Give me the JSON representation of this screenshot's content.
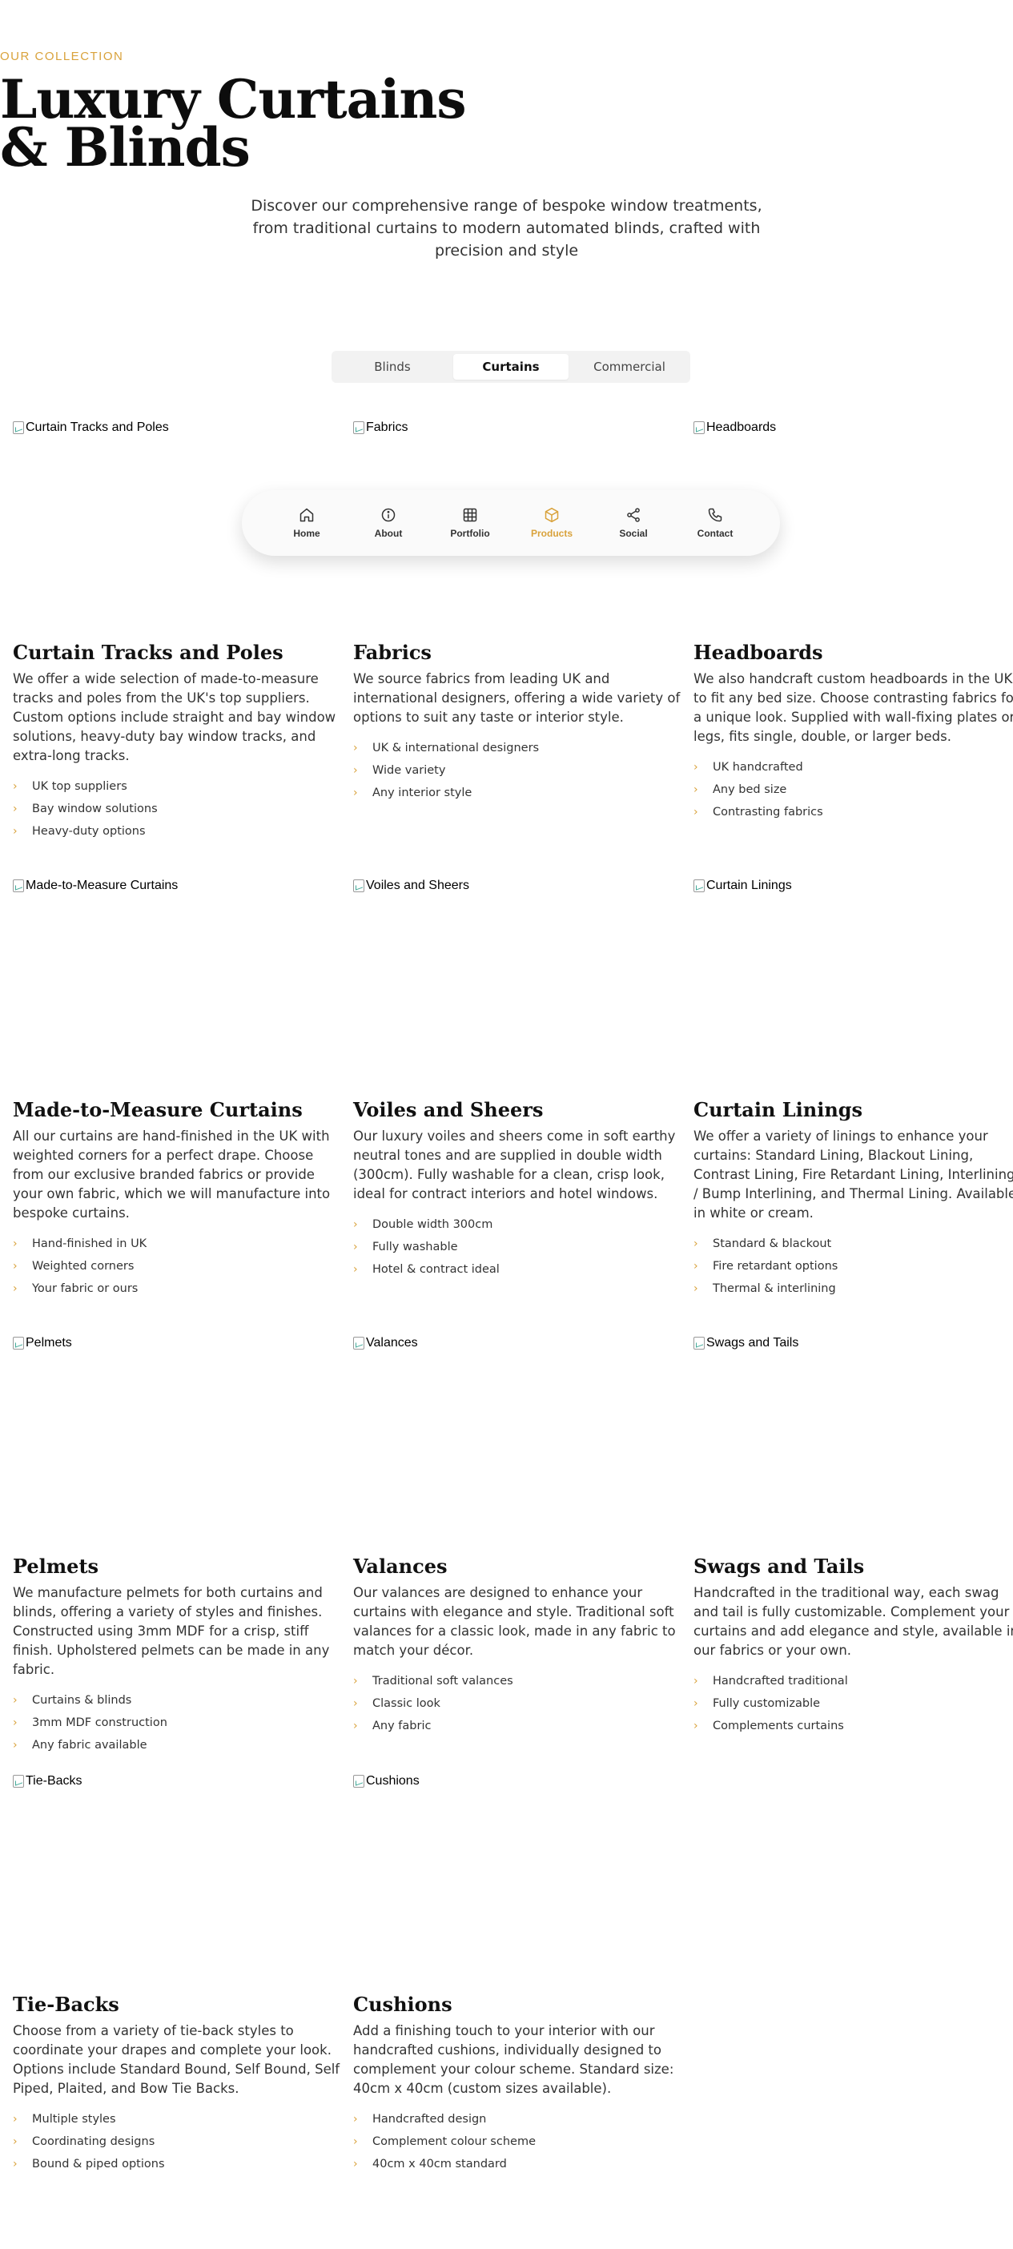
{
  "hero": {
    "eyebrow": "OUR COLLECTION",
    "title_line1": "Luxury Curtains",
    "title_line2": "& Blinds",
    "subtitle": "Discover our comprehensive range of bespoke window treatments, from traditional curtains to modern automated blinds, crafted with precision and style"
  },
  "tabs": [
    {
      "label": "Blinds",
      "active": false
    },
    {
      "label": "Curtains",
      "active": true
    },
    {
      "label": "Commercial",
      "active": false
    }
  ],
  "nav": [
    {
      "label": "Home",
      "icon": "home-icon"
    },
    {
      "label": "About",
      "icon": "info-icon"
    },
    {
      "label": "Portfolio",
      "icon": "grid-icon"
    },
    {
      "label": "Products",
      "icon": "box-icon",
      "active": true
    },
    {
      "label": "Social",
      "icon": "share-icon"
    },
    {
      "label": "Contact",
      "icon": "phone-icon"
    }
  ],
  "accent_color": "#d9a23b",
  "products": [
    {
      "alt": "Curtain Tracks and Poles",
      "title": "Curtain Tracks and Poles",
      "desc": "We offer a wide selection of made-to-measure tracks and poles from the UK's top suppliers. Custom options include straight and bay window solutions, heavy-duty bay window tracks, and extra-long tracks.",
      "features": [
        "UK top suppliers",
        "Bay window solutions",
        "Heavy-duty options"
      ]
    },
    {
      "alt": "Fabrics",
      "title": "Fabrics",
      "desc": "We source fabrics from leading UK and international designers, offering a wide variety of options to suit any taste or interior style.",
      "features": [
        "UK & international designers",
        "Wide variety",
        "Any interior style"
      ]
    },
    {
      "alt": "Headboards",
      "title": "Headboards",
      "desc": "We also handcraft custom headboards in the UK to fit any bed size. Choose contrasting fabrics for a unique look. Supplied with wall-fixing plates or legs, fits single, double, or larger beds.",
      "features": [
        "UK handcrafted",
        "Any bed size",
        "Contrasting fabrics"
      ]
    },
    {
      "alt": "Made-to-Measure Curtains",
      "title": "Made-to-Measure Curtains",
      "desc": "All our curtains are hand-finished in the UK with weighted corners for a perfect drape. Choose from our exclusive branded fabrics or provide your own fabric, which we will manufacture into bespoke curtains.",
      "features": [
        "Hand-finished in UK",
        "Weighted corners",
        "Your fabric or ours"
      ]
    },
    {
      "alt": "Voiles and Sheers",
      "title": "Voiles and Sheers",
      "desc": "Our luxury voiles and sheers come in soft earthy neutral tones and are supplied in double width (300cm). Fully washable for a clean, crisp look, ideal for contract interiors and hotel windows.",
      "features": [
        "Double width 300cm",
        "Fully washable",
        "Hotel & contract ideal"
      ]
    },
    {
      "alt": "Curtain Linings",
      "title": "Curtain Linings",
      "desc": "We offer a variety of linings to enhance your curtains: Standard Lining, Blackout Lining, Contrast Lining, Fire Retardant Lining, Interlining / Bump Interlining, and Thermal Lining. Available in white or cream.",
      "features": [
        "Standard & blackout",
        "Fire retardant options",
        "Thermal & interlining"
      ]
    },
    {
      "alt": "Pelmets",
      "title": "Pelmets",
      "desc": "We manufacture pelmets for both curtains and blinds, offering a variety of styles and finishes. Constructed using 3mm MDF for a crisp, stiff finish. Upholstered pelmets can be made in any fabric.",
      "features": [
        "Curtains & blinds",
        "3mm MDF construction",
        "Any fabric available"
      ]
    },
    {
      "alt": "Valances",
      "title": "Valances",
      "desc": "Our valances are designed to enhance your curtains with elegance and style. Traditional soft valances for a classic look, made in any fabric to match your décor.",
      "features": [
        "Traditional soft valances",
        "Classic look",
        "Any fabric"
      ]
    },
    {
      "alt": "Swags and Tails",
      "title": "Swags and Tails",
      "desc": "Handcrafted in the traditional way, each swag and tail is fully customizable. Complement your curtains and add elegance and style, available in our fabrics or your own.",
      "features": [
        "Handcrafted traditional",
        "Fully customizable",
        "Complements curtains"
      ]
    },
    {
      "alt": "Tie-Backs",
      "title": "Tie-Backs",
      "desc": "Choose from a variety of tie-back styles to coordinate your drapes and complete your look. Options include Standard Bound, Self Bound, Self Piped, Plaited, and Bow Tie Backs.",
      "features": [
        "Multiple styles",
        "Coordinating designs",
        "Bound & piped options"
      ]
    },
    {
      "alt": "Cushions",
      "title": "Cushions",
      "desc": "Add a finishing touch to your interior with our handcrafted cushions, individually designed to complement your colour scheme. Standard size: 40cm x 40cm (custom sizes available).",
      "features": [
        "Handcrafted design",
        "Complement colour scheme",
        "40cm x 40cm standard"
      ]
    }
  ]
}
